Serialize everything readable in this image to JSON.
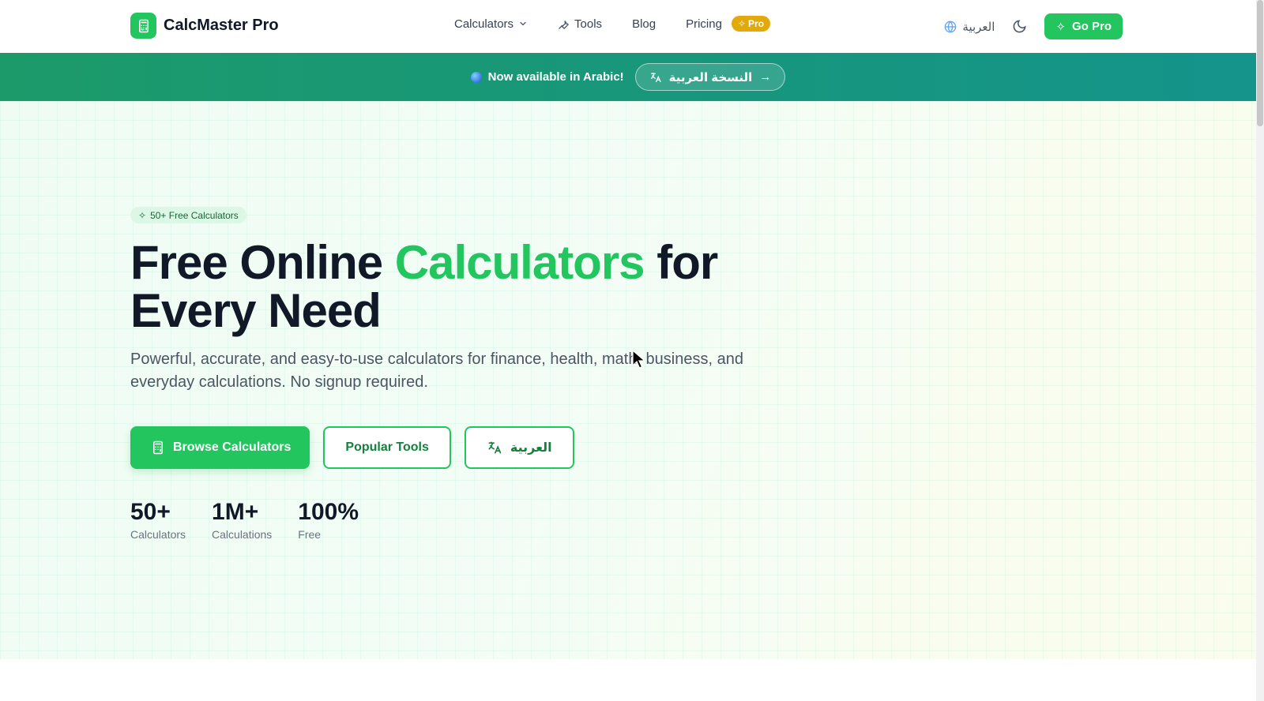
{
  "header": {
    "brand": "CalcMaster Pro",
    "nav": {
      "calculators": "Calculators",
      "tools": "Tools",
      "blog": "Blog",
      "pricing": "Pricing",
      "pro_badge": "Pro"
    },
    "language_link": "العربية",
    "go_pro": "Go Pro"
  },
  "banner": {
    "text": "Now available in Arabic!",
    "button": "النسخة العربية"
  },
  "hero": {
    "chip": "50+ Free Calculators",
    "headline_part1": "Free Online ",
    "headline_accent": "Calculators",
    "headline_part2": " for Every Need",
    "subtitle": "Powerful, accurate, and easy-to-use calculators for finance, health, math, business, and everyday calculations. No signup required.",
    "buttons": {
      "browse": "Browse Calculators",
      "popular": "Popular Tools",
      "arabic": "العربية"
    },
    "stats": [
      {
        "value": "50+",
        "label": "Calculators"
      },
      {
        "value": "1M+",
        "label": "Calculations"
      },
      {
        "value": "100%",
        "label": "Free"
      }
    ]
  },
  "colors": {
    "brand_green": "#22c55e",
    "banner_teal": "#179a7c",
    "pro_gold": "#e2a90c"
  }
}
